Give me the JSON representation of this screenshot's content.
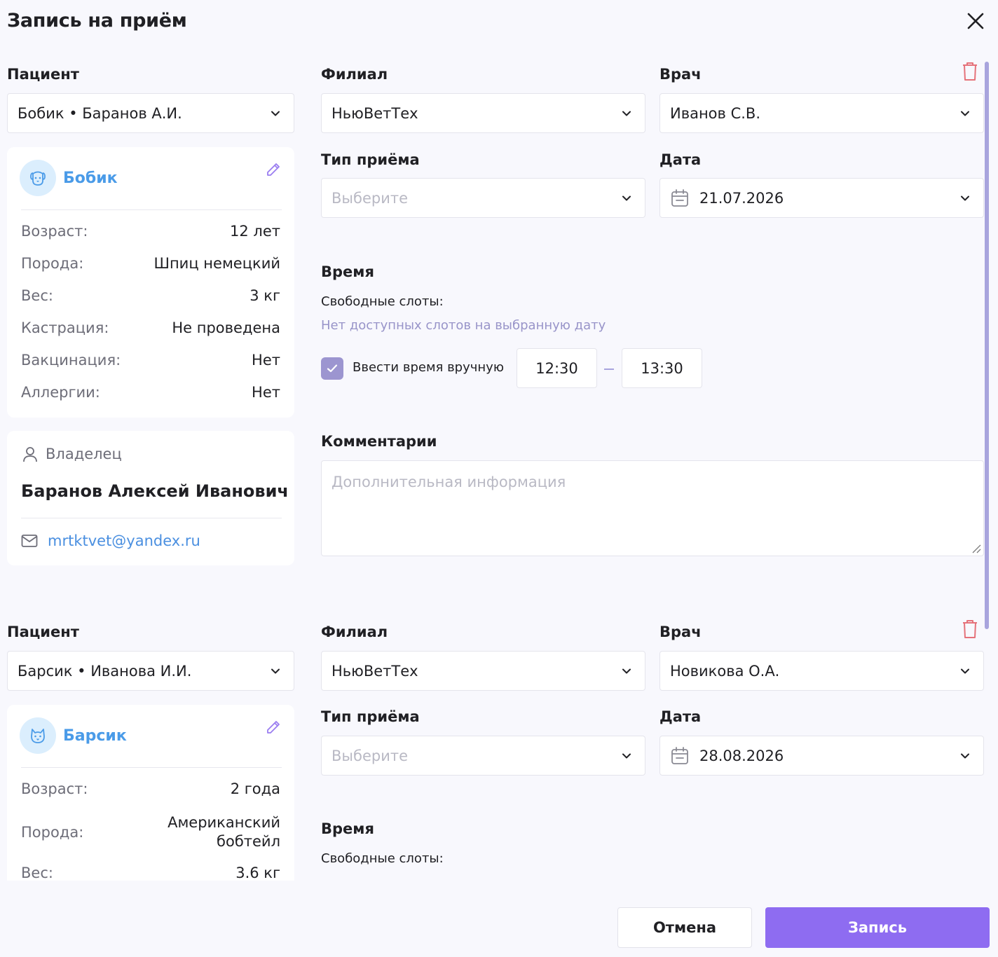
{
  "dialog": {
    "title": "Запись на приём",
    "cancel_label": "Отмена",
    "submit_label": "Запись"
  },
  "appointments": [
    {
      "patient_label": "Пациент",
      "patient_value": "Бобик • Баранов А.И.",
      "pet": {
        "name": "Бобик",
        "avatar_icon": "dog-icon",
        "fields": [
          {
            "k": "Возраст:",
            "v": "12 лет"
          },
          {
            "k": "Порода:",
            "v": "Шпиц немецкий"
          },
          {
            "k": "Вес:",
            "v": "3 кг"
          },
          {
            "k": "Кастрация:",
            "v": "Не проведена"
          },
          {
            "k": "Вакцинация:",
            "v": "Нет"
          },
          {
            "k": "Аллергии:",
            "v": "Нет"
          }
        ]
      },
      "owner": {
        "label": "Владелец",
        "name": "Баранов Алексей Иванович",
        "email": "mrtktvet@yandex.ru"
      },
      "branch_label": "Филиал",
      "branch_value": "НьюВетТех",
      "doctor_label": "Врач",
      "doctor_value": "Иванов С.В.",
      "type_label": "Тип приёма",
      "type_placeholder": "Выберите",
      "date_label": "Дата",
      "date_value": "21.07.2026",
      "time_label": "Время",
      "slots_label": "Свободные слоты:",
      "no_slots": "Нет доступных слотов на выбранную дату",
      "manual_time_label": "Ввести время вручную",
      "manual_time_checked": true,
      "time_from": "12:30",
      "time_to": "13:30",
      "comments_label": "Комментарии",
      "comments_placeholder": "Дополнительная информация"
    },
    {
      "patient_label": "Пациент",
      "patient_value": "Барсик • Иванова И.И.",
      "pet": {
        "name": "Барсик",
        "avatar_icon": "cat-icon",
        "fields": [
          {
            "k": "Возраст:",
            "v": "2 года"
          },
          {
            "k": "Порода:",
            "v": "Американский бобтейл"
          },
          {
            "k": "Вес:",
            "v": "3.6 кг"
          }
        ]
      },
      "branch_label": "Филиал",
      "branch_value": "НьюВетТех",
      "doctor_label": "Врач",
      "doctor_value": "Новикова О.А.",
      "type_label": "Тип приёма",
      "type_placeholder": "Выберите",
      "date_label": "Дата",
      "date_value": "28.08.2026",
      "time_label": "Время",
      "slots_label": "Свободные слоты:"
    }
  ],
  "colors": {
    "accent": "#8e6cf1",
    "pet_name": "#4a9be8",
    "delete": "#e5727a",
    "checkbox": "#9c95d0"
  }
}
